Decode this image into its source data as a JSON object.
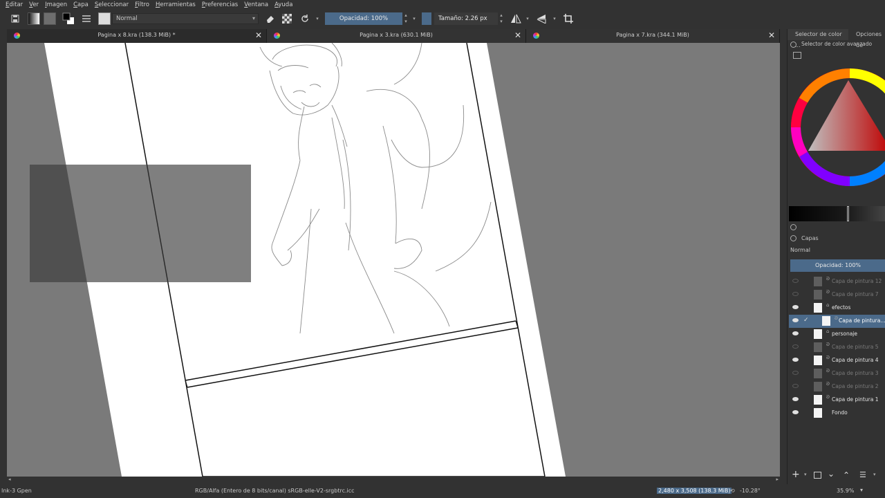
{
  "menu": [
    "Editar",
    "Ver",
    "Imagen",
    "Capa",
    "Seleccionar",
    "Filtro",
    "Herramientas",
    "Preferencias",
    "Ventana",
    "Ayuda"
  ],
  "toolbar": {
    "blend_mode": "Normal",
    "opacity_label": "Opacidad: 100%",
    "size_label": "Tamaño: 2.26 px",
    "colors": {
      "slider_blue": "#4b6a8a",
      "bg": "#323232"
    }
  },
  "tabs": [
    {
      "label": "Pagina x 8.kra (138.3 MiB) *",
      "close": "✕"
    },
    {
      "label": "Pagina x 3.kra (630.1 MiB)",
      "close": "✕"
    },
    {
      "label": "Pagina x 7.kra (344.1 MiB)",
      "close": "✕"
    }
  ],
  "docker": {
    "tab1": "Selector de color ...",
    "tab2": "Opciones de",
    "color_title": "Selector de color avanzado",
    "layers_title": "Capas",
    "blend_mode": "Normal",
    "opacity_label": "Opacidad:  100%"
  },
  "layers": [
    {
      "name": "Capa de pintura 12",
      "visible": false,
      "kind": "paint",
      "thumb": "gray"
    },
    {
      "name": "Capa de pintura 7",
      "visible": false,
      "kind": "paint",
      "thumb": "gray"
    },
    {
      "name": "efectos",
      "visible": true,
      "kind": "group",
      "thumb": "white"
    },
    {
      "name": "Capa de pintura...",
      "visible": true,
      "kind": "paint",
      "thumb": "white",
      "selected": true
    },
    {
      "name": "personaje",
      "visible": true,
      "kind": "group",
      "thumb": "white"
    },
    {
      "name": "Capa de pintura 5",
      "visible": false,
      "kind": "paint",
      "thumb": "gray"
    },
    {
      "name": "Capa de pintura 4",
      "visible": true,
      "kind": "paint",
      "thumb": "white"
    },
    {
      "name": "Capa de pintura 3",
      "visible": false,
      "kind": "paint",
      "thumb": "gray"
    },
    {
      "name": "Capa de pintura 2",
      "visible": false,
      "kind": "paint",
      "thumb": "gray"
    },
    {
      "name": "Capa de pintura 1",
      "visible": true,
      "kind": "paint",
      "thumb": "white"
    },
    {
      "name": "Fondo",
      "visible": true,
      "kind": "paint",
      "thumb": "white"
    }
  ],
  "status": {
    "brush": "Ink-3 Gpen",
    "color_space": "RGB/Alfa (Entero de 8 bits/canal)  sRGB-elle-V2-srgbtrc.icc",
    "dimensions": "2,480 x 3,508 (138.3 MiB)",
    "rotation": "-10.28°",
    "zoom": "35.9%"
  }
}
